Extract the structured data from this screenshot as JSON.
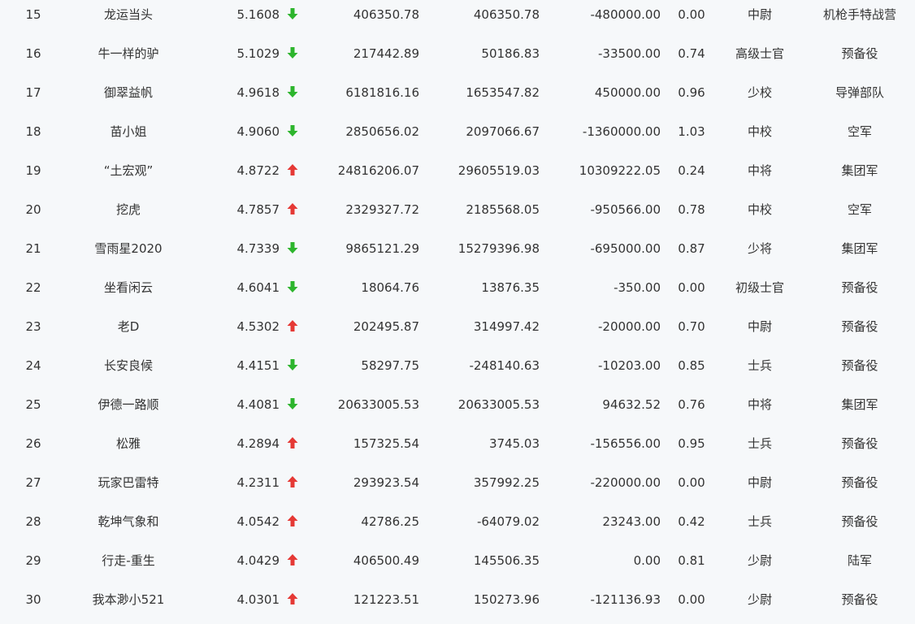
{
  "colors": {
    "up": "#e53935",
    "down": "#2db52d",
    "text": "#333333",
    "background": "#f6f8fa"
  },
  "rows": [
    {
      "rank": "15",
      "name": "龙运当头",
      "score": "5.1608",
      "trend": "down",
      "trend_icon": "arrow-down-icon",
      "v1": "406350.78",
      "v2": "406350.78",
      "v3": "-480000.00",
      "ratio": "0.00",
      "title": "中尉",
      "unit": "机枪手特战营"
    },
    {
      "rank": "16",
      "name": "牛一样的驴",
      "score": "5.1029",
      "trend": "down",
      "trend_icon": "arrow-down-icon",
      "v1": "217442.89",
      "v2": "50186.83",
      "v3": "-33500.00",
      "ratio": "0.74",
      "title": "高级士官",
      "unit": "预备役"
    },
    {
      "rank": "17",
      "name": "御翠益帆",
      "score": "4.9618",
      "trend": "down",
      "trend_icon": "arrow-down-icon",
      "v1": "6181816.16",
      "v2": "1653547.82",
      "v3": "450000.00",
      "ratio": "0.96",
      "title": "少校",
      "unit": "导弹部队"
    },
    {
      "rank": "18",
      "name": "苗小姐",
      "score": "4.9060",
      "trend": "down",
      "trend_icon": "arrow-down-icon",
      "v1": "2850656.02",
      "v2": "2097066.67",
      "v3": "-1360000.00",
      "ratio": "1.03",
      "title": "中校",
      "unit": "空军"
    },
    {
      "rank": "19",
      "name": "“土宏观”",
      "score": "4.8722",
      "trend": "up",
      "trend_icon": "arrow-up-icon",
      "v1": "24816206.07",
      "v2": "29605519.03",
      "v3": "10309222.05",
      "ratio": "0.24",
      "title": "中将",
      "unit": "集团军"
    },
    {
      "rank": "20",
      "name": "挖虎",
      "score": "4.7857",
      "trend": "up",
      "trend_icon": "arrow-up-icon",
      "v1": "2329327.72",
      "v2": "2185568.05",
      "v3": "-950566.00",
      "ratio": "0.78",
      "title": "中校",
      "unit": "空军"
    },
    {
      "rank": "21",
      "name": "雪雨星2020",
      "score": "4.7339",
      "trend": "down",
      "trend_icon": "arrow-down-icon",
      "v1": "9865121.29",
      "v2": "15279396.98",
      "v3": "-695000.00",
      "ratio": "0.87",
      "title": "少将",
      "unit": "集团军"
    },
    {
      "rank": "22",
      "name": "坐看闲云",
      "score": "4.6041",
      "trend": "down",
      "trend_icon": "arrow-down-icon",
      "v1": "18064.76",
      "v2": "13876.35",
      "v3": "-350.00",
      "ratio": "0.00",
      "title": "初级士官",
      "unit": "预备役"
    },
    {
      "rank": "23",
      "name": "老D",
      "score": "4.5302",
      "trend": "up",
      "trend_icon": "arrow-up-icon",
      "v1": "202495.87",
      "v2": "314997.42",
      "v3": "-20000.00",
      "ratio": "0.70",
      "title": "中尉",
      "unit": "预备役"
    },
    {
      "rank": "24",
      "name": "长安良候",
      "score": "4.4151",
      "trend": "down",
      "trend_icon": "arrow-down-icon",
      "v1": "58297.75",
      "v2": "-248140.63",
      "v3": "-10203.00",
      "ratio": "0.85",
      "title": "士兵",
      "unit": "预备役"
    },
    {
      "rank": "25",
      "name": "伊德一路顺",
      "score": "4.4081",
      "trend": "down",
      "trend_icon": "arrow-down-icon",
      "v1": "20633005.53",
      "v2": "20633005.53",
      "v3": "94632.52",
      "ratio": "0.76",
      "title": "中将",
      "unit": "集团军"
    },
    {
      "rank": "26",
      "name": "松雅",
      "score": "4.2894",
      "trend": "up",
      "trend_icon": "arrow-up-icon",
      "v1": "157325.54",
      "v2": "3745.03",
      "v3": "-156556.00",
      "ratio": "0.95",
      "title": "士兵",
      "unit": "预备役"
    },
    {
      "rank": "27",
      "name": "玩家巴雷特",
      "score": "4.2311",
      "trend": "up",
      "trend_icon": "arrow-up-icon",
      "v1": "293923.54",
      "v2": "357992.25",
      "v3": "-220000.00",
      "ratio": "0.00",
      "title": "中尉",
      "unit": "预备役"
    },
    {
      "rank": "28",
      "name": "乾坤气象和",
      "score": "4.0542",
      "trend": "up",
      "trend_icon": "arrow-up-icon",
      "v1": "42786.25",
      "v2": "-64079.02",
      "v3": "23243.00",
      "ratio": "0.42",
      "title": "士兵",
      "unit": "预备役"
    },
    {
      "rank": "29",
      "name": "行走-重生",
      "score": "4.0429",
      "trend": "up",
      "trend_icon": "arrow-up-icon",
      "v1": "406500.49",
      "v2": "145506.35",
      "v3": "0.00",
      "ratio": "0.81",
      "title": "少尉",
      "unit": "陆军"
    },
    {
      "rank": "30",
      "name": "我本渺小521",
      "score": "4.0301",
      "trend": "up",
      "trend_icon": "arrow-up-icon",
      "v1": "121223.51",
      "v2": "150273.96",
      "v3": "-121136.93",
      "ratio": "0.00",
      "title": "少尉",
      "unit": "预备役"
    }
  ]
}
